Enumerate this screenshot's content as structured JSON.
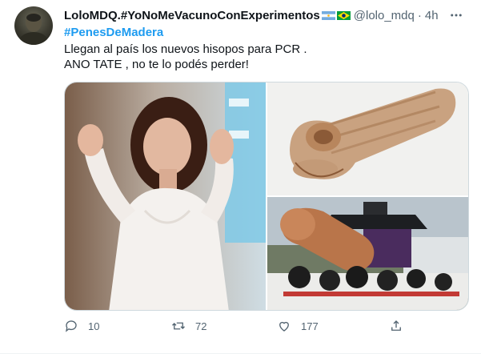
{
  "tweet": {
    "author_name": "LoloMDQ.#YoNoMeVacunoConExperimentos",
    "handle": "@lolo_mdq",
    "separator": "·",
    "time": "4h",
    "hashtag": "#PenesDeMadera",
    "line1": "Llegan al país los nuevos hisopos para PCR .",
    "line2": "ANO TATE , no te lo podés perder!"
  },
  "actions": {
    "replies": "10",
    "retweets": "72",
    "likes": "177"
  },
  "colors": {
    "link": "#1d9bf0",
    "secondary": "#536471",
    "border": "#cfd9de"
  },
  "icons": [
    "more-icon",
    "reply-icon",
    "retweet-icon",
    "like-icon",
    "share-icon"
  ]
}
